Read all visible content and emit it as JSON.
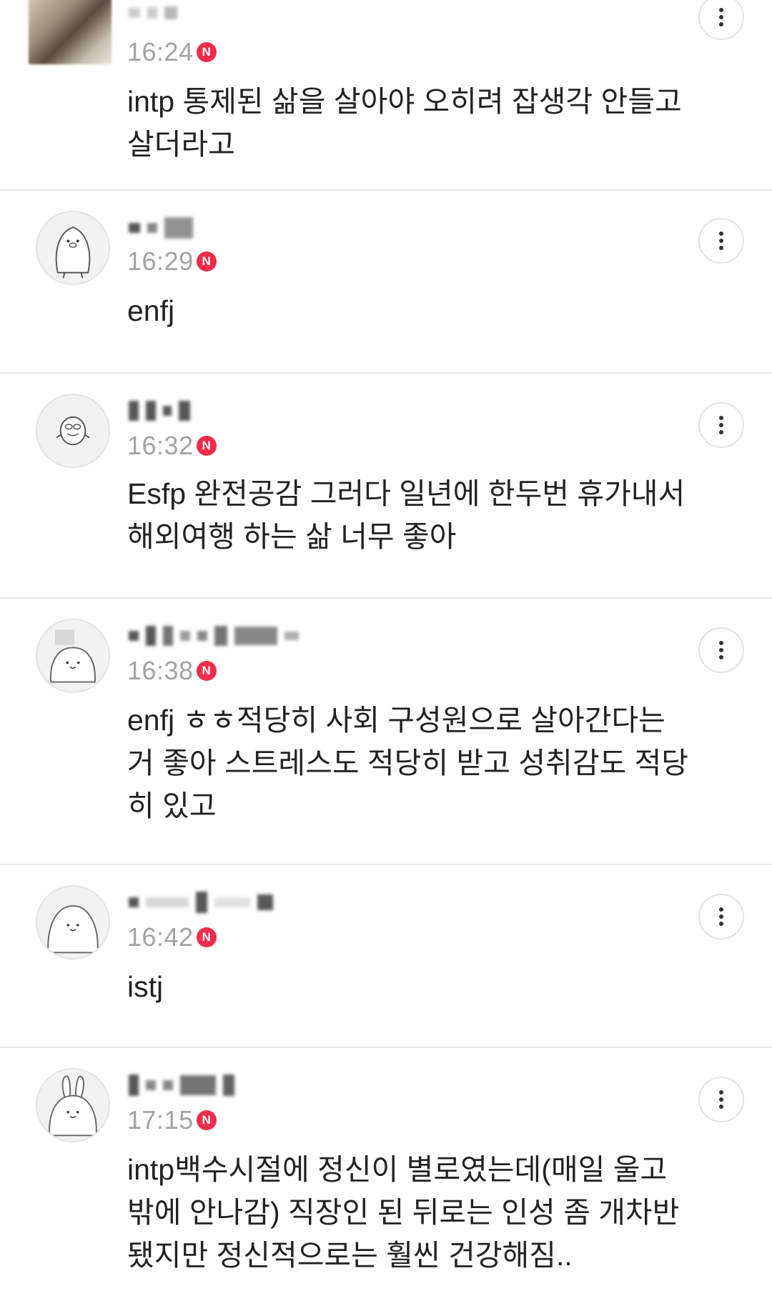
{
  "comments": [
    {
      "avatar_icon": "blurred-photo-avatar",
      "time": "16:24",
      "new_badge": "N",
      "text": "intp 통제된 삶을 살아야 오히려 잡생각 안들고\n살더라고"
    },
    {
      "avatar_icon": "penguin-avatar",
      "time": "16:29",
      "new_badge": "N",
      "text": "enfj"
    },
    {
      "avatar_icon": "duck-avatar",
      "time": "16:32",
      "new_badge": "N",
      "text": "Esfp 완전공감 그러다 일년에 한두번 휴가내서\n해외여행 하는 삶 너무 좋아"
    },
    {
      "avatar_icon": "bear-character-avatar",
      "time": "16:38",
      "new_badge": "N",
      "text": "enfj ㅎㅎ적당히 사회 구성원으로 살아간다는\n거 좋아 스트레스도 적당히 받고 성취감도 적당\n히 있고"
    },
    {
      "avatar_icon": "round-character-avatar",
      "time": "16:42",
      "new_badge": "N",
      "text": "istj"
    },
    {
      "avatar_icon": "rabbit-avatar",
      "time": "17:15",
      "new_badge": "N",
      "text": "intp백수시절에 정신이 별로였는데(매일 울고\n밖에 안나감) 직장인 된 뒤로는 인성 좀 개차반\n됐지만 정신적으로는 훨씬 건강해짐.."
    }
  ],
  "more_icon": "more-vertical-icon",
  "colors": {
    "badge": "#ee2c4b",
    "time": "#a3a3a3",
    "divider": "#e8e8e8",
    "text": "#222222"
  }
}
